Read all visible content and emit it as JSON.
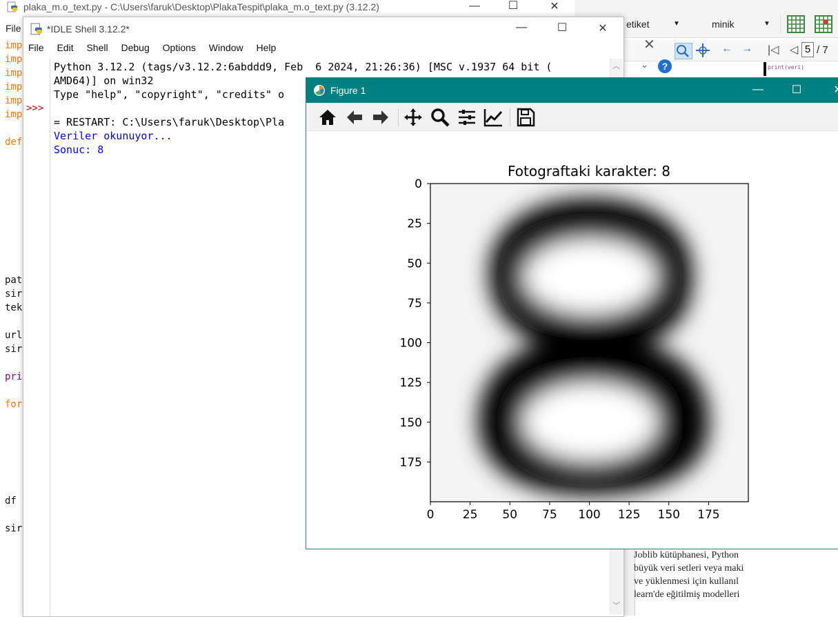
{
  "editor": {
    "title": "plaka_m.o_text.py - C:\\Users\\faruk\\Desktop\\PlakaTespit\\plaka_m.o_text.py (3.12.2)",
    "menu_file": "File",
    "code_fragments": [
      {
        "text": "imp",
        "color": "#ff7700"
      },
      {
        "text": "imp",
        "color": "#ff7700"
      },
      {
        "text": "imp",
        "color": "#ff7700"
      },
      {
        "text": "imp",
        "color": "#ff7700"
      },
      {
        "text": "imp",
        "color": "#ff7700"
      },
      {
        "text": "imp",
        "color": "#ff7700"
      },
      {
        "text": "def",
        "color": "#ff7700"
      },
      {
        "text": "pat",
        "color": "#111111"
      },
      {
        "text": "sir",
        "color": "#111111"
      },
      {
        "text": "tek",
        "color": "#111111"
      },
      {
        "text": "url",
        "color": "#111111"
      },
      {
        "text": "sir",
        "color": "#111111"
      },
      {
        "text": "pri",
        "color": "#900090"
      },
      {
        "text": "for",
        "color": "#ff7700"
      },
      {
        "text": "df",
        "color": "#111111"
      },
      {
        "text": "sir",
        "color": "#111111"
      }
    ]
  },
  "docapp": {
    "style_dropdown": "etiket",
    "size_dropdown": "minik",
    "page_current": "5",
    "page_total": "/ 7",
    "snippet": "print(veri)",
    "paper_lines": [
      "Joblib kütüphanesi, Python",
      "büyük veri setleri veya maki",
      "ve yüklenmesi için kullanıl",
      "learn'de eğitilmiş modelleri"
    ]
  },
  "idle": {
    "title": "*IDLE Shell 3.12.2*",
    "menu": [
      "File",
      "Edit",
      "Shell",
      "Debug",
      "Options",
      "Window",
      "Help"
    ],
    "prompt": ">>>",
    "lines": [
      {
        "text": "Python 3.12.2 (tags/v3.12.2:6abddd9, Feb  6 2024, 21:26:36) [MSC v.1937 64 bit (",
        "color": "#000000"
      },
      {
        "text": "AMD64)] on win32",
        "color": "#000000"
      },
      {
        "text": "Type \"help\", \"copyright\", \"credits\" o",
        "color": "#000000"
      },
      {
        "text": "",
        "color": "#000000"
      },
      {
        "text": "= RESTART: C:\\Users\\faruk\\Desktop\\Pla",
        "color": "#000000"
      },
      {
        "text": "Veriler okunuyor...",
        "color": "#0000ff"
      },
      {
        "text": "Sonuc: 8",
        "color": "#0000ff"
      }
    ]
  },
  "figure": {
    "title": "Figure 1",
    "tools": [
      "home-icon",
      "back-arrow-icon",
      "forward-arrow-icon",
      "pan-icon",
      "zoom-icon",
      "configure-subplots-icon",
      "edit-axis-icon",
      "save-icon"
    ]
  },
  "chart_data": {
    "type": "heatmap",
    "title": "Fotograftaki karakter: 8",
    "xlabel": "",
    "ylabel": "",
    "colormap": "gray",
    "image_size": [
      200,
      200
    ],
    "xlim": [
      0,
      200
    ],
    "ylim": [
      200,
      0
    ],
    "xticks": [
      0,
      25,
      50,
      75,
      100,
      125,
      150,
      175
    ],
    "yticks": [
      0,
      25,
      50,
      75,
      100,
      125,
      150,
      175
    ],
    "content": "blurred black digit 8 on white background"
  }
}
